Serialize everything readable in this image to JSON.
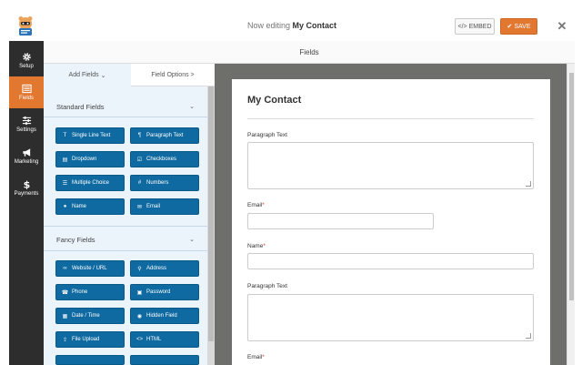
{
  "header": {
    "title_prefix": "Now editing",
    "form_name": "My Contact",
    "embed_label": "EMBED",
    "embed_icon": "</>",
    "save_label": "SAVE",
    "close_label": "✕"
  },
  "sidenav": {
    "items": [
      {
        "label": "Setup",
        "icon": "gear-icon"
      },
      {
        "label": "Fields",
        "icon": "list-icon",
        "active": true
      },
      {
        "label": "Settings",
        "icon": "sliders-icon"
      },
      {
        "label": "Marketing",
        "icon": "megaphone-icon"
      },
      {
        "label": "Payments",
        "icon": "dollar-icon"
      }
    ]
  },
  "fields_header": "Fields",
  "panel": {
    "tab_add": "Add Fields",
    "tab_add_chevron": "⌄",
    "tab_options": "Field Options",
    "tab_options_chevron": ">",
    "standard_title": "Standard Fields",
    "fancy_title": "Fancy Fields",
    "section_chevron": "⌄",
    "standard_fields": [
      {
        "label": "Single Line Text",
        "icon": "T"
      },
      {
        "label": "Paragraph Text",
        "icon": "¶"
      },
      {
        "label": "Dropdown",
        "icon": "▤"
      },
      {
        "label": "Checkboxes",
        "icon": "☑"
      },
      {
        "label": "Multiple Choice",
        "icon": "☰"
      },
      {
        "label": "Numbers",
        "icon": "#"
      },
      {
        "label": "Name",
        "icon": "●"
      },
      {
        "label": "Email",
        "icon": "✉"
      }
    ],
    "fancy_fields": [
      {
        "label": "Website / URL",
        "icon": "∞"
      },
      {
        "label": "Address",
        "icon": "⚲"
      },
      {
        "label": "Phone",
        "icon": "☎"
      },
      {
        "label": "Password",
        "icon": "▣"
      },
      {
        "label": "Date / Time",
        "icon": "▦"
      },
      {
        "label": "Hidden Field",
        "icon": "◉"
      },
      {
        "label": "File Upload",
        "icon": "⇪"
      },
      {
        "label": "HTML",
        "icon": "<>"
      }
    ]
  },
  "form": {
    "title": "My Contact",
    "fields": [
      {
        "label": "Paragraph Text",
        "required": false
      },
      {
        "label": "Email",
        "required": true
      },
      {
        "label": "Name",
        "required": true
      },
      {
        "label": "Paragraph Text",
        "required": false
      },
      {
        "label": "Email",
        "required": true
      }
    ],
    "required_mark": "*"
  },
  "colors": {
    "accent": "#e27730",
    "field_button": "#0e6aa0",
    "sidebar": "#2d2d2d",
    "panel_bg": "#ebf3fb",
    "preview_bg": "#6e6f6a"
  }
}
